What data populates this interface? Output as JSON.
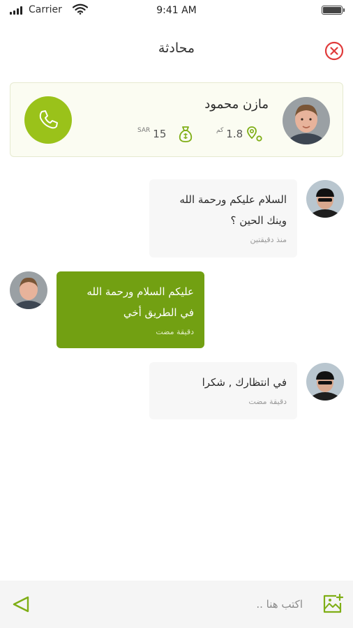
{
  "status_bar": {
    "carrier": "Carrier",
    "time": "9:41 AM"
  },
  "header": {
    "title": "محادثة",
    "close_icon": "close-circle-icon"
  },
  "driver": {
    "name": "مازن محمود",
    "distance_value": "1.8",
    "distance_unit": "كم",
    "fare_value": "15",
    "fare_unit": "SAR",
    "call_icon": "phone-icon"
  },
  "messages": [
    {
      "direction": "incoming",
      "text": "السلام عليكم ورحمة الله\nوينك الحين ؟",
      "time": "منذ دقيقتين"
    },
    {
      "direction": "outgoing",
      "text": "عليكم السلام ورحمة الله\nفي الطريق أخي",
      "time": "دقيقة مضت"
    },
    {
      "direction": "incoming",
      "text": "في انتظارك , شكرا",
      "time": "دقيقة مضت"
    }
  ],
  "composer": {
    "placeholder": "اكتب هنا ..",
    "value": "",
    "send_icon": "send-icon",
    "attach_icon": "add-image-icon"
  },
  "colors": {
    "accent": "#9ac21a",
    "outgoing_bubble": "#72a012",
    "incoming_bubble": "#f7f7f7",
    "close": "#e03a3a"
  }
}
